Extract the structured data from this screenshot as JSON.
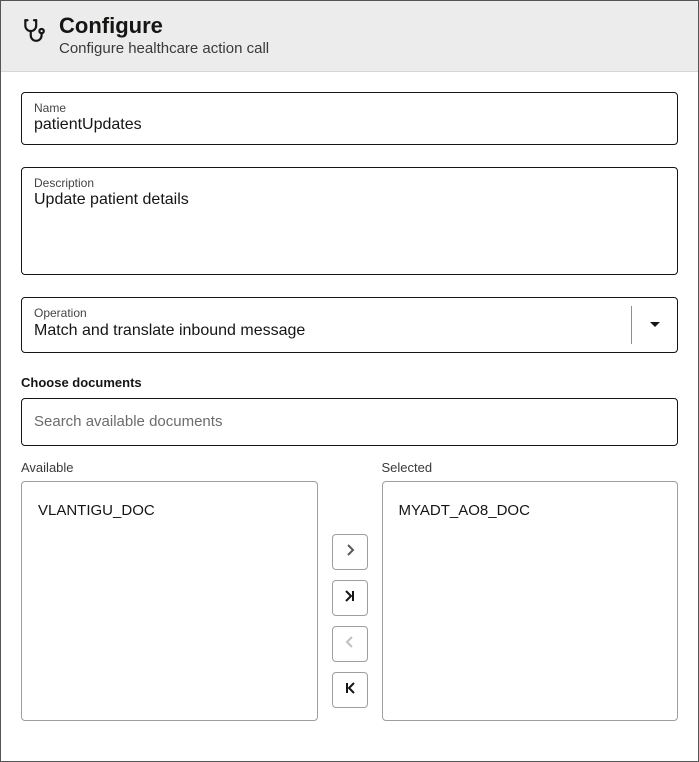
{
  "header": {
    "title": "Configure",
    "subtitle": "Configure healthcare action call"
  },
  "fields": {
    "name": {
      "label": "Name",
      "value": "patientUpdates"
    },
    "description": {
      "label": "Description",
      "value": "Update patient details"
    },
    "operation": {
      "label": "Operation",
      "value": "Match and translate inbound message"
    }
  },
  "documents": {
    "section_label": "Choose documents",
    "search_placeholder": "Search available documents",
    "available_label": "Available",
    "selected_label": "Selected",
    "available": [
      "VLANTIGU_DOC"
    ],
    "selected": [
      "MYADT_AO8_DOC"
    ]
  }
}
